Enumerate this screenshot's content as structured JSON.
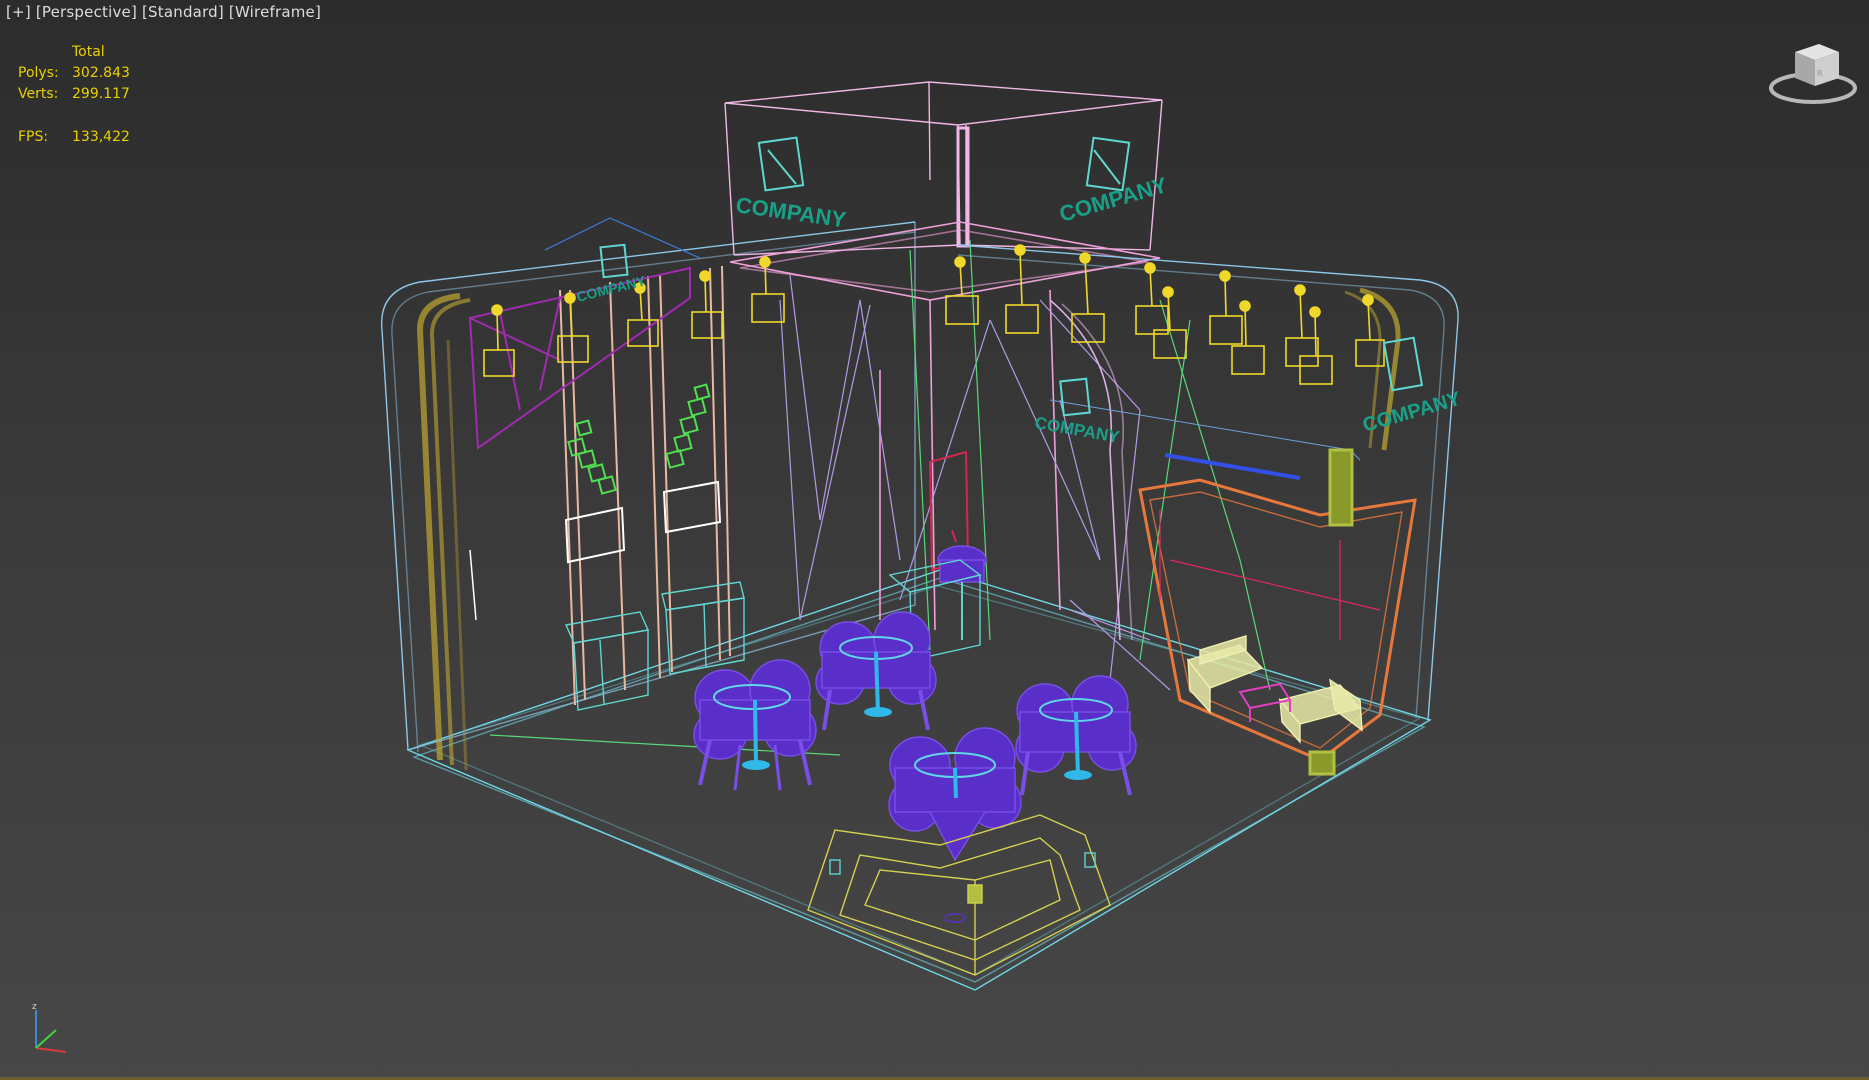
{
  "viewport": {
    "plus": "[+]",
    "view": "[Perspective]",
    "shading": "[Standard]",
    "mode": "[Wireframe]"
  },
  "stats": {
    "header": "Total",
    "polys_label": "Polys:",
    "polys_value": "302.843",
    "verts_label": "Verts:",
    "verts_value": "299.117",
    "fps_label": "FPS:",
    "fps_value": "133,422"
  },
  "scene_labels": {
    "company": "COMPANY"
  },
  "colors": {
    "stats_text": "#e8d000",
    "floor_wire": "#6fd7e6",
    "wall_wire": "#8ec6e8",
    "tower_wire": "#f1b6e6",
    "truss_wire": "#e8d29a",
    "lamp": "#f0d82a",
    "chairs": "#5a2ec8",
    "company_logo": "#1aa088",
    "plant": "#4ee04e",
    "arch_wire": "#b39ae6",
    "counter_wire": "#d4d050",
    "frame_orange": "#e7783c"
  },
  "icons": {
    "viewcube": "viewcube-icon",
    "axis": "axis-tripod-icon"
  }
}
